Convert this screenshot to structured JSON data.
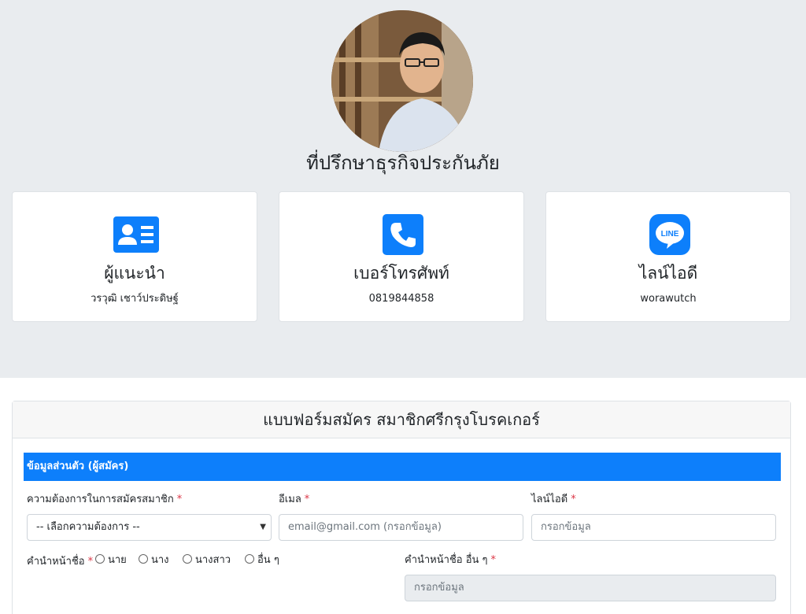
{
  "hero": {
    "title": "ที่ปรึกษาธุรกิจประกันภัย"
  },
  "cards": [
    {
      "title": "ผู้แนะนำ",
      "value": "วรวุฒิ เชาว์ประดิษฐ์",
      "icon": "contact-card-icon"
    },
    {
      "title": "เบอร์โทรศัพท์",
      "value": "0819844858",
      "icon": "phone-icon"
    },
    {
      "title": "ไลน์ไอดี",
      "value": "worawutch",
      "icon": "line-icon"
    }
  ],
  "colors": {
    "accent": "#0d7ffb",
    "hero_bg": "#e9ecef",
    "required": "#dc3545"
  },
  "form": {
    "title": "แบบฟอร์มสมัคร สมาชิกศรีกรุงโบรคเกอร์",
    "section": "ข้อมูลส่วนตัว (ผู้สมัคร)",
    "required_mark": "*",
    "need": {
      "label": "ความต้องการในการสมัครสมาชิก",
      "selected": "-- เลือกความต้องการ --"
    },
    "email": {
      "label": "อีเมล",
      "placeholder": "email@gmail.com (กรอกข้อมูล)"
    },
    "line": {
      "label": "ไลน์ไอดี",
      "placeholder": "กรอกข้อมูล"
    },
    "prefix": {
      "label": "คำนำหน้าชื่อ",
      "options": [
        "นาย",
        "นาง",
        "นางสาว",
        "อื่น ๆ"
      ]
    },
    "other_prefix": {
      "label": "คำนำหน้าชื่อ อื่น ๆ",
      "placeholder": "กรอกข้อมูล"
    }
  }
}
